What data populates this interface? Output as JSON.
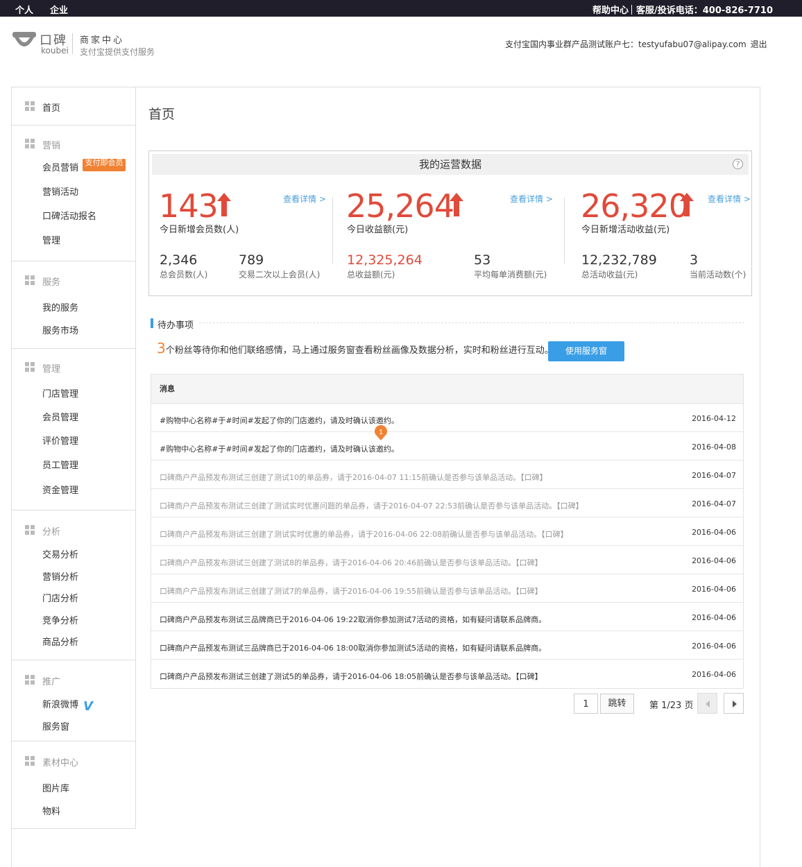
{
  "topbar": {
    "personal": "个人",
    "enterprise": "企业",
    "help": "帮助中心",
    "service": "客服/投诉电话：400-826-7710"
  },
  "header": {
    "logo_cn": "口碑",
    "logo_en": "koubei",
    "title": "商家中心",
    "subtitle": "支付宝提供支付服务",
    "account": "支付宝国内事业群产品测试账户七：testyufabu07@alipay.com",
    "logout": "退出"
  },
  "sidebar": {
    "home": "首页",
    "marketing": {
      "head": "营销",
      "items": [
        "会员营销",
        "营销活动",
        "口碑活动报名",
        "管理"
      ],
      "badge": "支付即会员"
    },
    "service": {
      "head": "服务",
      "items": [
        "我的服务",
        "服务市场"
      ]
    },
    "manage": {
      "head": "管理",
      "items": [
        "门店管理",
        "会员管理",
        "评价管理",
        "员工管理",
        "资金管理"
      ]
    },
    "analysis": {
      "head": "分析",
      "items": [
        "交易分析",
        "营销分析",
        "门店分析",
        "竞争分析",
        "商品分析"
      ]
    },
    "promo": {
      "head": "推广",
      "items": [
        "新浪微博",
        "服务窗"
      ]
    },
    "material": {
      "head": "素材中心",
      "items": [
        "图片库",
        "物料"
      ]
    }
  },
  "main": {
    "title": "首页",
    "stats": {
      "head": "我的运营数据",
      "help": "?",
      "more": "查看详情 >",
      "blocks": [
        {
          "big": "143",
          "big_label": "今日新增会员数(人)",
          "a_num": "2,346",
          "a_label": "总会员数(人)",
          "b_num": "789",
          "b_label": "交易二次以上会员(人)"
        },
        {
          "big": "25,264",
          "big_label": "今日收益额(元)",
          "a_num": "12,325,264",
          "a_label": "总收益额(元)",
          "b_num": "53",
          "b_label": "平均每单消费额(元)"
        },
        {
          "big": "26,320",
          "big_label": "今日新增活动收益(元)",
          "a_num": "12,232,789",
          "a_label": "总活动收益(元)",
          "b_num": "3",
          "b_label": "当前活动数(个)"
        }
      ]
    },
    "todo": {
      "title": "待办事项",
      "count": "3",
      "notice": "个粉丝等待你和他们联络感情，马上通过服务窗查看粉丝画像及数据分析，实时和粉丝进行互动。",
      "button": "使用服务窗"
    },
    "messages": {
      "header": "消息",
      "pin": "1",
      "rows": [
        {
          "text": "#购物中心名称#于#时间#发起了你的门店邀约，请及时确认该邀约。",
          "date": "2016-04-12"
        },
        {
          "text": "#购物中心名称#于#时间#发起了你的门店邀约，请及时确认该邀约。",
          "date": "2016-04-08"
        },
        {
          "text": "口碑商户产品预发布测试三创建了测试10的单品券，请于2016-04-07 11:15前确认是否参与该单品活动。【口碑】",
          "date": "2016-04-07"
        },
        {
          "text": "口碑商户产品预发布测试三创建了测试实时优惠问题的单品券，请于2016-04-07 22:53前确认是否参与该单品活动。【口碑】",
          "date": "2016-04-07"
        },
        {
          "text": "口碑商户产品预发布测试三创建了测试实时优惠的单品券，请于2016-04-06 22:08前确认是否参与该单品活动。【口碑】",
          "date": "2016-04-06"
        },
        {
          "text": "口碑商户产品预发布测试三创建了测试8的单品券，请于2016-04-06 20:46前确认是否参与该单品活动。【口碑】",
          "date": "2016-04-06"
        },
        {
          "text": "口碑商户产品预发布测试三创建了测试7的单品券，请于2016-04-06 19:55前确认是否参与该单品活动。【口碑】",
          "date": "2016-04-06"
        },
        {
          "text": "口碑商户产品预发布测试三品牌商已于2016-04-06 19:22取消你参加测试7活动的资格，如有疑问请联系品牌商。",
          "date": "2016-04-06"
        },
        {
          "text": "口碑商户产品预发布测试三品牌商已于2016-04-06 18:00取消你参加测试5活动的资格，如有疑问请联系品牌商。",
          "date": "2016-04-06"
        },
        {
          "text": "口碑商户产品预发布测试三创建了测试5的单品券，请于2016-04-06 18:05前确认是否参与该单品活动。【口碑】",
          "date": "2016-04-06"
        }
      ]
    },
    "pagination": {
      "page": "1",
      "jump": "跳转",
      "info": "第 1/23 页"
    }
  }
}
